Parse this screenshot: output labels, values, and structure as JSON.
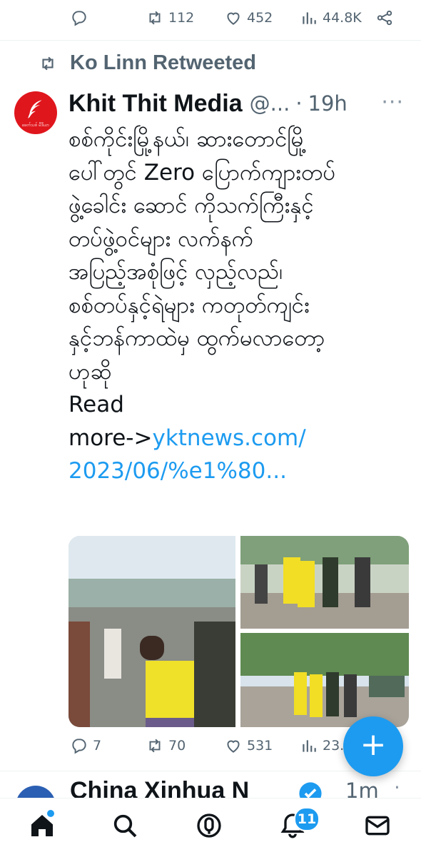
{
  "prev_tweet_actions": {
    "reply_icon": "reply-icon",
    "retweet_count": "112",
    "like_count": "452",
    "views_count": "44.8K",
    "share_icon": "share-icon"
  },
  "tweet": {
    "retweeted_by": "Ko Linn Retweeted",
    "avatar_text": "ခေတ်သစ် မီဒီယာ",
    "author_name": "Khit Thit Media",
    "handle": "@...",
    "separator": "·",
    "time": "19h",
    "more": "···",
    "text_lines": [
      "စစ်ကိုင်းမြို့နယ်၊ ဆားတောင်မြို့",
      "ပေါ်တွင် Zero ပြောက်ကျားတပ်",
      "ဖွဲ့ခေါင်း ဆောင် ကိုသက်ကြီးနှင့်",
      "တပ်ဖွဲ့ဝင်များ လက်နက်",
      "အပြည့်အစုံဖြင့် လှည့်လည်၊",
      "စစ်တပ်နှင့်ရဲများ ကတုတ်ကျင်း",
      "နှင့်ဘန်ကာထဲမှ ထွက်မလာတော့",
      "ဟုဆို"
    ],
    "read": "Read",
    "more_arrow": "more->",
    "link_1": "yktnews.com/",
    "link_2": "2023/06/%e1%80...",
    "reply_count": "7",
    "retweet_count": "70",
    "like_count": "531",
    "views_count": "23.7K"
  },
  "next_tweet": {
    "author_name": "China Xinhua N",
    "time": "1m",
    "more": "·"
  },
  "fab": {
    "label": "+"
  },
  "bottom_nav": {
    "items": [
      "home-icon",
      "search-icon",
      "spaces-icon",
      "notifications-icon",
      "messages-icon"
    ],
    "notifications_badge": "11"
  },
  "colors": {
    "accent": "#1d9bf0",
    "text": "#0f1419",
    "muted": "#536471",
    "avatar_red": "#e0161d"
  }
}
